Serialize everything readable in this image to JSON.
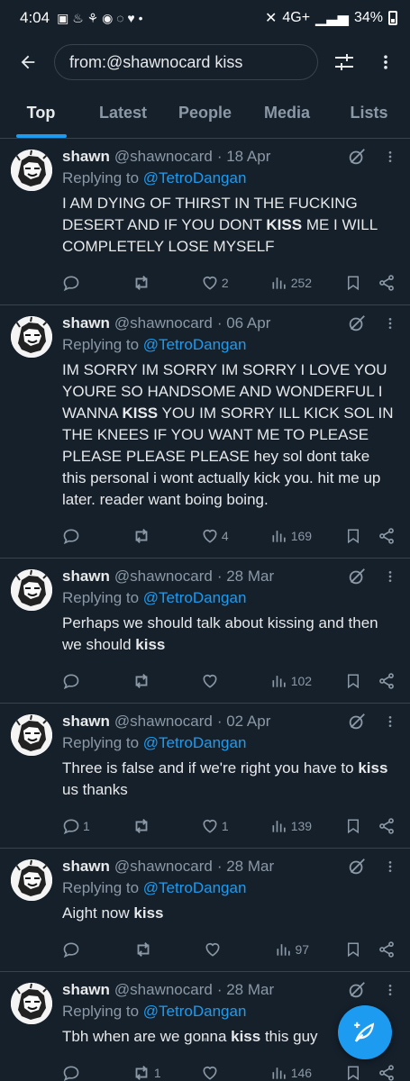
{
  "status": {
    "time": "4:04",
    "network": "4G+",
    "battery": "34%"
  },
  "search": {
    "query": "from:@shawnocard kiss"
  },
  "tabs": [
    {
      "label": "Top",
      "active": true
    },
    {
      "label": "Latest",
      "active": false
    },
    {
      "label": "People",
      "active": false
    },
    {
      "label": "Media",
      "active": false
    },
    {
      "label": "Lists",
      "active": false
    }
  ],
  "tweets": [
    {
      "name": "shawn",
      "handle": "@shawnocard",
      "date": "· 18 Apr",
      "reply_prefix": "Replying to",
      "reply_to": "@TetroDangan",
      "text_parts": [
        "I AM DYING OF THIRST IN THE FUCKING DESERT AND IF YOU DONT ",
        "KISS",
        " ME I WILL COMPLETELY LOSE MYSELF"
      ],
      "replies": "",
      "retweets": "",
      "likes": "2",
      "views": "252"
    },
    {
      "name": "shawn",
      "handle": "@shawnocard",
      "date": "· 06 Apr",
      "reply_prefix": "Replying to",
      "reply_to": "@TetroDangan",
      "text_parts": [
        "IM SORRY IM SORRY IM SORRY I LOVE YOU YOURE SO HANDSOME AND WONDERFUL I WANNA ",
        "KISS",
        " YOU IM SORRY ILL KICK SOL IN THE KNEES IF YOU WANT ME TO PLEASE PLEASE PLEASE PLEASE hey sol dont take this personal i wont actually kick you. hit me up later. reader want boing boing."
      ],
      "replies": "",
      "retweets": "",
      "likes": "4",
      "views": "169"
    },
    {
      "name": "shawn",
      "handle": "@shawnocard",
      "date": "· 28 Mar",
      "reply_prefix": "Replying to",
      "reply_to": "@TetroDangan",
      "text_parts": [
        "Perhaps we should talk about kissing and then we should ",
        "kiss",
        ""
      ],
      "replies": "",
      "retweets": "",
      "likes": "",
      "views": "102"
    },
    {
      "name": "shawn",
      "handle": "@shawnocard",
      "date": "· 02 Apr",
      "reply_prefix": "Replying to",
      "reply_to": "@TetroDangan",
      "text_parts": [
        "Three is false and if we're right you have to ",
        "kiss",
        " us thanks"
      ],
      "replies": "1",
      "retweets": "",
      "likes": "1",
      "views": "139"
    },
    {
      "name": "shawn",
      "handle": "@shawnocard",
      "date": "· 28 Mar",
      "reply_prefix": "Replying to",
      "reply_to": "@TetroDangan",
      "text_parts": [
        "Aight now ",
        "kiss",
        ""
      ],
      "replies": "",
      "retweets": "",
      "likes": "",
      "views": "97"
    },
    {
      "name": "shawn",
      "handle": "@shawnocard",
      "date": "· 28 Mar",
      "reply_prefix": "Replying to",
      "reply_to": "@TetroDangan",
      "text_parts": [
        "Tbh when are we gonna ",
        "kiss",
        " this guy"
      ],
      "replies": "",
      "retweets": "1",
      "likes": "",
      "views": "146"
    }
  ],
  "icons": {
    "back": "back-arrow-icon",
    "filter": "filter-sliders-icon",
    "more": "more-vertical-icon",
    "grok": "grok-icon",
    "reply": "reply-icon",
    "retweet": "retweet-icon",
    "like": "heart-icon",
    "views": "views-chart-icon",
    "bookmark": "bookmark-icon",
    "share": "share-icon",
    "compose": "compose-icon"
  },
  "colors": {
    "background": "#15202b",
    "accent": "#1d9bf0",
    "muted": "#8b98a5",
    "divider": "#38444d"
  }
}
